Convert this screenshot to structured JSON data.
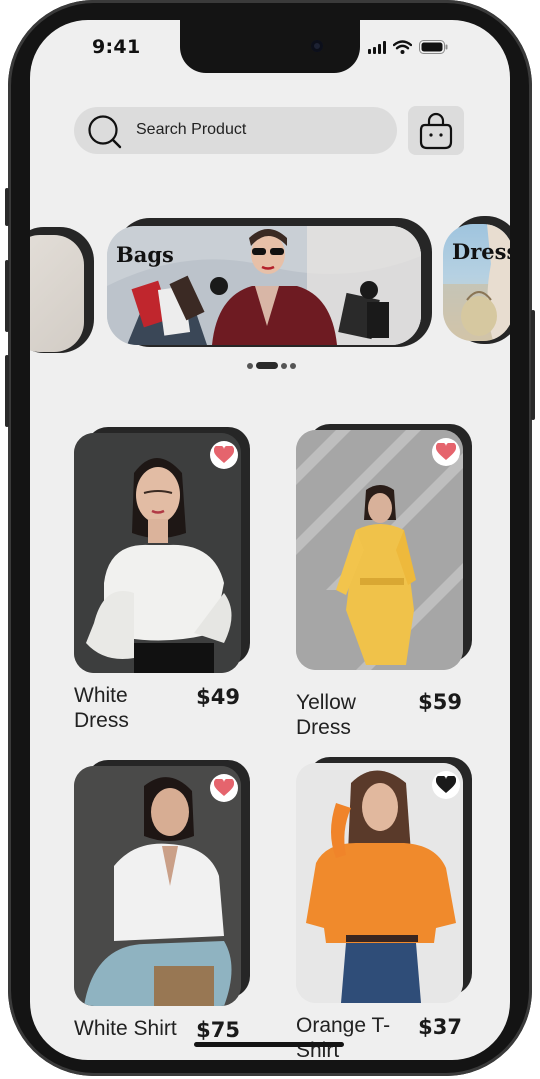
{
  "status_bar": {
    "time": "9:41"
  },
  "search": {
    "placeholder": "Search Product"
  },
  "icons": {
    "search": "search-icon",
    "cart": "shopping-bag-icon",
    "favorite": "heart-icon",
    "signal": "cellular-signal-icon",
    "wifi": "wifi-icon",
    "battery": "battery-icon"
  },
  "categories": [
    {
      "label": ""
    },
    {
      "label": "Bags"
    },
    {
      "label": "Dress"
    }
  ],
  "carousel": {
    "page_count": 4,
    "active_index": 1
  },
  "colors": {
    "background": "#efefef",
    "pill": "#dcdcdc",
    "favorite_active": "#e5646d",
    "favorite_dark": "#1a1a1a"
  },
  "products": [
    {
      "name": "White Dress",
      "price": "$49",
      "favorite_color": "#e5646d"
    },
    {
      "name": "Yellow Dress",
      "price": "$59",
      "favorite_color": "#e5646d"
    },
    {
      "name": "White Shirt",
      "price": "$75",
      "favorite_color": "#e5646d"
    },
    {
      "name": "Orange T-Shirt",
      "price": "$37",
      "favorite_color": "#1a1a1a"
    }
  ]
}
